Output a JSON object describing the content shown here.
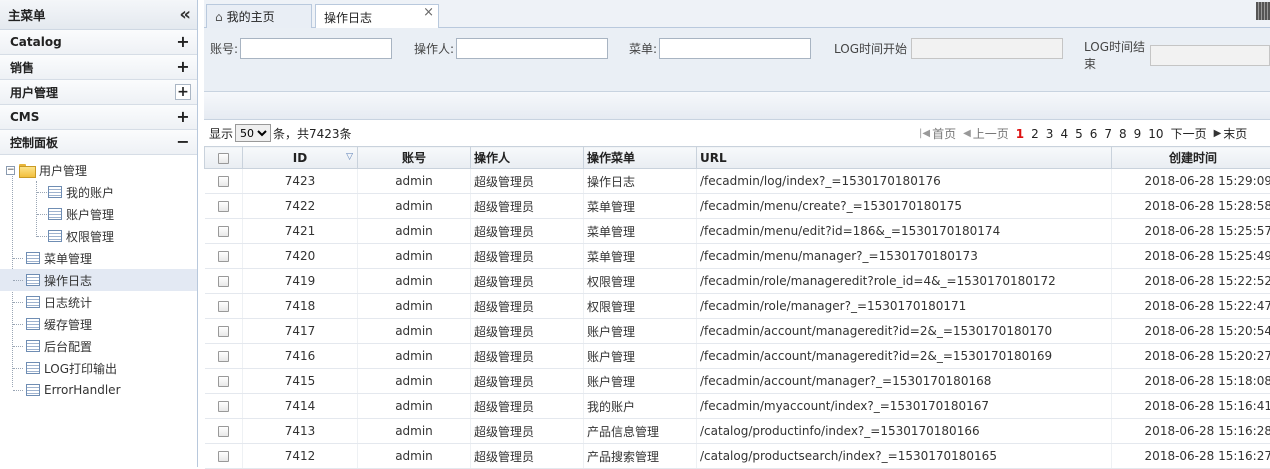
{
  "sidebar": {
    "title": "主菜单",
    "sections": [
      {
        "label": "Catalog",
        "toggle": "+"
      },
      {
        "label": "销售",
        "toggle": "+"
      },
      {
        "label": "用户管理",
        "toggle": "+"
      },
      {
        "label": "CMS",
        "toggle": "+"
      },
      {
        "label": "控制面板",
        "toggle": "−"
      }
    ],
    "tree": {
      "folder": "用户管理",
      "folder_children": [
        "我的账户",
        "账户管理",
        "权限管理"
      ],
      "items": [
        "菜单管理",
        "操作日志",
        "日志统计",
        "缓存管理",
        "后台配置",
        "LOG打印输出",
        "ErrorHandler"
      ],
      "fold_symbol": "−"
    }
  },
  "tabs": {
    "home_label": "我的主页",
    "active_label": "操作日志",
    "close_symbol": "×"
  },
  "search": {
    "account_label": "账号:",
    "operator_label": "操作人:",
    "menu_label": "菜单:",
    "log_start_label": "LOG时间开始",
    "log_end_label": "LOG时间结束"
  },
  "pager": {
    "show_label": "显示",
    "page_size": "50",
    "summary": "条，共7423条",
    "first": "首页",
    "prev": "上一页",
    "pages": [
      "1",
      "2",
      "3",
      "4",
      "5",
      "6",
      "7",
      "8",
      "9",
      "10"
    ],
    "current_page": "1",
    "next": "下一页",
    "last": "末页"
  },
  "table": {
    "columns": [
      "ID",
      "账号",
      "操作人",
      "操作菜单",
      "URL",
      "创建时间"
    ],
    "rows": [
      [
        "7423",
        "admin",
        "超级管理员",
        "操作日志",
        "/fecadmin/log/index?_=1530170180176",
        "2018-06-28 15:29:09"
      ],
      [
        "7422",
        "admin",
        "超级管理员",
        "菜单管理",
        "/fecadmin/menu/create?_=1530170180175",
        "2018-06-28 15:28:58"
      ],
      [
        "7421",
        "admin",
        "超级管理员",
        "菜单管理",
        "/fecadmin/menu/edit?id=186&_=1530170180174",
        "2018-06-28 15:25:57"
      ],
      [
        "7420",
        "admin",
        "超级管理员",
        "菜单管理",
        "/fecadmin/menu/manager?_=1530170180173",
        "2018-06-28 15:25:49"
      ],
      [
        "7419",
        "admin",
        "超级管理员",
        "权限管理",
        "/fecadmin/role/manageredit?role_id=4&_=1530170180172",
        "2018-06-28 15:22:52"
      ],
      [
        "7418",
        "admin",
        "超级管理员",
        "权限管理",
        "/fecadmin/role/manager?_=1530170180171",
        "2018-06-28 15:22:47"
      ],
      [
        "7417",
        "admin",
        "超级管理员",
        "账户管理",
        "/fecadmin/account/manageredit?id=2&_=1530170180170",
        "2018-06-28 15:20:54"
      ],
      [
        "7416",
        "admin",
        "超级管理员",
        "账户管理",
        "/fecadmin/account/manageredit?id=2&_=1530170180169",
        "2018-06-28 15:20:27"
      ],
      [
        "7415",
        "admin",
        "超级管理员",
        "账户管理",
        "/fecadmin/account/manager?_=1530170180168",
        "2018-06-28 15:18:08"
      ],
      [
        "7414",
        "admin",
        "超级管理员",
        "我的账户",
        "/fecadmin/myaccount/index?_=1530170180167",
        "2018-06-28 15:16:41"
      ],
      [
        "7413",
        "admin",
        "超级管理员",
        "产品信息管理",
        "/catalog/productinfo/index?_=1530170180166",
        "2018-06-28 15:16:28"
      ],
      [
        "7412",
        "admin",
        "超级管理员",
        "产品搜索管理",
        "/catalog/productsearch/index?_=1530170180165",
        "2018-06-28 15:16:27"
      ]
    ]
  }
}
